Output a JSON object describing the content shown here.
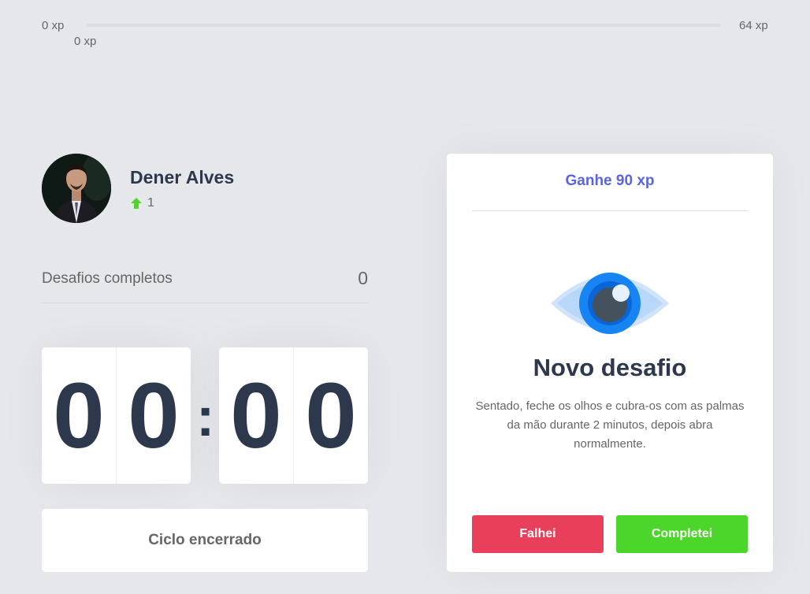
{
  "xp_bar": {
    "min_label": "0 xp",
    "max_label": "64 xp",
    "current_label": "0 xp",
    "progress_fraction": 0
  },
  "profile": {
    "name": "Dener Alves",
    "level": "1",
    "level_icon": "level-up-arrow-icon"
  },
  "challenges": {
    "label": "Desafios completos",
    "count": "0"
  },
  "countdown": {
    "minute_tens": "0",
    "minute_ones": "0",
    "separator": ":",
    "second_tens": "0",
    "second_ones": "0"
  },
  "cycle_button": {
    "label": "Ciclo encerrado"
  },
  "challenge_card": {
    "gain": "Ganhe 90 xp",
    "icon": "eye-icon",
    "title": "Novo desafio",
    "description": "Sentado, feche os olhos e cubra-os com as palmas da mão durante 2 minutos, depois abra normalmente.",
    "fail_label": "Falhei",
    "done_label": "Completei"
  },
  "colors": {
    "background": "#e6e7eb",
    "title": "#2e384d",
    "text": "#666666",
    "blue": "#5965e0",
    "red": "#e83f5b",
    "green": "#4cd62b"
  }
}
